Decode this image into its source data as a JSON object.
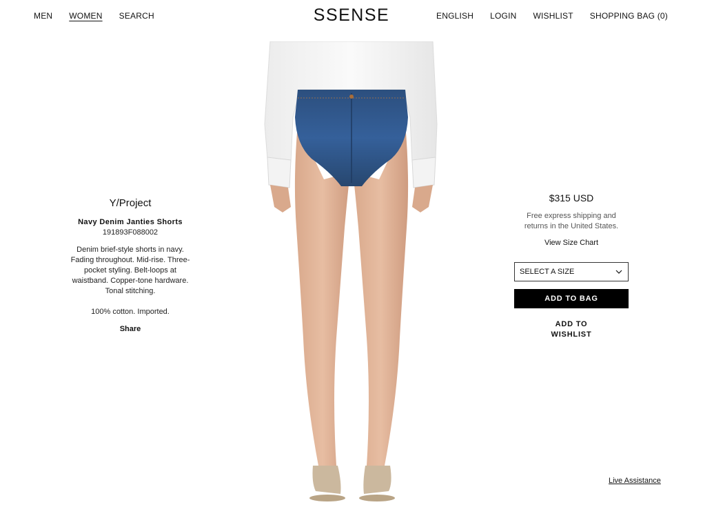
{
  "header": {
    "left_nav": [
      "MEN",
      "WOMEN",
      "SEARCH"
    ],
    "logo": "SSENSE",
    "right_nav": [
      "ENGLISH",
      "LOGIN",
      "WISHLIST",
      "SHOPPING BAG (0)"
    ]
  },
  "product": {
    "brand": "Y/Project",
    "name": "Navy Denim Janties Shorts",
    "sku": "191893F088002",
    "description": "Denim brief-style shorts in navy. Fading throughout. Mid-rise. Three-pocket styling. Belt-loops at waistband. Copper-tone hardware. Tonal stitching.",
    "composition": "100% cotton. Imported.",
    "share_label": "Share"
  },
  "purchase": {
    "price": "$315 USD",
    "shipping_note": "Free express shipping and returns in the United States.",
    "size_chart_label": "View Size Chart",
    "size_select": "SELECT A SIZE",
    "add_to_bag": "ADD TO BAG",
    "add_to_wishlist": "ADD TO WISHLIST"
  },
  "support": {
    "live_assistance": "Live Assistance"
  },
  "colors": {
    "background": "#ffffff",
    "text": "#111111",
    "button_bg": "#000000",
    "denim": "#2c4f7e"
  }
}
